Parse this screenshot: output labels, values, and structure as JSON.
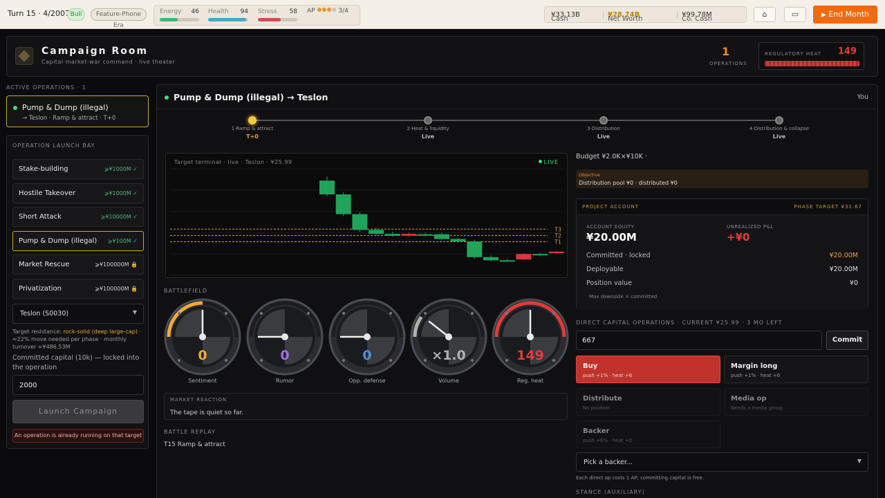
{
  "topbar": {
    "turn": "Turn 15 · 4/2007",
    "market": "Bull",
    "era": "Feature-Phone Era",
    "stats": [
      {
        "label": "Energy",
        "value": "46",
        "pct": 46,
        "color": "#4caf7d"
      },
      {
        "label": "Health",
        "value": "94",
        "pct": 94,
        "color": "#4aa3c8"
      },
      {
        "label": "Stress",
        "value": "58",
        "pct": 58,
        "color": "#d84a5a"
      }
    ],
    "ap_label": "AP",
    "ap_value": "3/4",
    "cash_label": "Cash",
    "cash_value": "¥33.13B",
    "networth_label": "Net Worth",
    "networth_value": "¥28.74B",
    "cocash_label": "Co. Cash",
    "cocash_value": "¥99.78M",
    "home_icon": "⌂",
    "screen_icon": "▭",
    "end_icon": "▶",
    "end_label": "End Month"
  },
  "header": {
    "title": "Campaign Room",
    "subtitle": "Capital market-war command · live theater",
    "ops_count": "1",
    "ops_label": "OPERATIONS",
    "heat_label": "REGULATORY HEAT",
    "heat_value": "149",
    "heat_pct": 100
  },
  "left": {
    "active_label": "ACTIVE OPERATIONS · 1",
    "active_op": {
      "title": "Pump & Dump (illegal)",
      "sub": "→ Teslon · Ramp & attract · T+0"
    },
    "bay_label": "OPERATION LAUNCH BAY",
    "ops": [
      {
        "name": "Stake-building",
        "req": "⩾¥1000M ✓",
        "state": "ok"
      },
      {
        "name": "Hostile Takeover",
        "req": "⩾¥1000M ✓",
        "state": "ok"
      },
      {
        "name": "Short Attack",
        "req": "⩾¥10000M ✓",
        "state": "ok"
      },
      {
        "name": "Pump & Dump (illegal)",
        "req": "⩾¥100M ✓",
        "state": "ok",
        "selected": true
      },
      {
        "name": "Market Rescue",
        "req": "⩾¥100000M 🔒",
        "state": "lock"
      },
      {
        "name": "Privatization",
        "req": "⩾¥100000M 🔒",
        "state": "lock"
      }
    ],
    "target_select": "Teslon (S0030)",
    "resist_prefix": "Target resistance: ",
    "resist_hl": "rock-solid (deep large-cap)",
    "resist_rest": " · ≈22% move needed per phase · monthly turnover ≈¥486.53M",
    "commit_label": "Committed capital (10k) — locked into the operation",
    "commit_value": "2000",
    "launch_label": "Launch Campaign",
    "warning": "An operation is already running on that target"
  },
  "main": {
    "title": "Pump & Dump (illegal) → Teslon",
    "you": "You",
    "phases": [
      {
        "name": "1·Ramp & attract",
        "state": "T+0",
        "active": true
      },
      {
        "name": "2·Heat & liquidity",
        "state": "Live",
        "active": false
      },
      {
        "name": "3·Distribution",
        "state": "Live",
        "active": false
      },
      {
        "name": "4·Distribution & collapse",
        "state": "Live",
        "active": false
      }
    ],
    "chart_title": "Target terminal · live · Teslon · ¥25.99",
    "live_label": "LIVE",
    "battlefield_label": "BATTLEFIELD",
    "gauges": [
      {
        "name": "Sentiment",
        "value": "0",
        "color": "#f2a93b",
        "level": 0.5
      },
      {
        "name": "Rumor",
        "value": "0",
        "color": "#a06cf0",
        "level": 0
      },
      {
        "name": "Opp. defense",
        "value": "0",
        "color": "#4a90e2",
        "level": 0
      },
      {
        "name": "Volume",
        "value": "×1.0",
        "color": "#b0b0b0",
        "level": 0.2
      },
      {
        "name": "Reg. heat",
        "value": "149",
        "color": "#e23b3b",
        "level": 1
      }
    ],
    "reaction_label": "MARKET REACTION",
    "reaction_text": "The tape is quiet so far.",
    "replay_label": "BATTLE REPLAY",
    "replay_items": [
      "T15 Ramp & attract"
    ]
  },
  "side": {
    "budget": "Budget ¥2.0K×¥10K ·",
    "objective_label": "Objective",
    "objective_text": "Distribution pool ¥0 · distributed ¥0",
    "account_title": "PROJECT ACCOUNT",
    "phase_target": "PHASE TARGET ¥31.67",
    "equity_label": "ACCOUNT EQUITY",
    "equity_value": "¥20.00M",
    "pnl_label": "UNREALIZED P&L",
    "pnl_value": "+¥0",
    "rows": [
      {
        "label": "Committed · locked",
        "value": "¥20.00M"
      },
      {
        "label": "Deployable",
        "value": "¥20.00M"
      },
      {
        "label": "Position value",
        "value": "¥0"
      }
    ],
    "note": "Max downside = committed",
    "direct_label": "DIRECT CAPITAL OPERATIONS · CURRENT ¥25.99 · 3 MO LEFT",
    "amount_value": "667",
    "commit_label": "Commit",
    "actions": [
      {
        "name": "Buy",
        "sub": "push +1% · heat +6",
        "style": "buy"
      },
      {
        "name": "Margin long",
        "sub": "push +1% · heat +6",
        "style": "normal"
      },
      {
        "name": "Distribute",
        "sub": "No position",
        "style": "disabled"
      },
      {
        "name": "Media op",
        "sub": "Needs a media group",
        "style": "disabled"
      },
      {
        "name": "Backer",
        "sub": "push +6% · heat +0",
        "style": "disabled"
      }
    ],
    "backer_select": "Pick a backer...",
    "ap_note": "Each direct op costs 1 AP; committing capital is free.",
    "stance_label": "STANCE (AUXILIARY)"
  },
  "chart_data": {
    "type": "candlestick",
    "title": "Target terminal · live · Teslon · ¥25.99",
    "levels": [
      {
        "name": "T3",
        "value": 31.7
      },
      {
        "name": "T2",
        "value": 30.1
      },
      {
        "name": "T1",
        "value": 28.5
      }
    ],
    "ylim": [
      20,
      47
    ],
    "candles": [
      {
        "o": 44.0,
        "c": 40.5,
        "h": 45.0,
        "l": 40.0
      },
      {
        "o": 40.5,
        "c": 35.5,
        "h": 41.0,
        "l": 35.0
      },
      {
        "o": 35.5,
        "c": 31.5,
        "h": 36.0,
        "l": 31.0
      },
      {
        "o": 31.5,
        "c": 30.5,
        "h": 32.0,
        "l": 30.0
      },
      {
        "o": 30.5,
        "c": 30.0,
        "h": 31.0,
        "l": 29.8
      },
      {
        "o": 30.0,
        "c": 30.5,
        "h": 30.8,
        "l": 29.8
      },
      {
        "o": 30.4,
        "c": 30.1,
        "h": 30.8,
        "l": 29.9
      },
      {
        "o": 30.4,
        "c": 29.2,
        "h": 30.8,
        "l": 29.0
      },
      {
        "o": 29.2,
        "c": 28.6,
        "h": 29.5,
        "l": 28.3
      },
      {
        "o": 28.6,
        "c": 24.6,
        "h": 29.0,
        "l": 24.2
      },
      {
        "o": 24.6,
        "c": 23.8,
        "h": 25.0,
        "l": 23.5
      },
      {
        "o": 23.8,
        "c": 23.8,
        "h": 24.2,
        "l": 23.5
      },
      {
        "o": 24.0,
        "c": 25.4,
        "h": 25.6,
        "l": 23.9
      },
      {
        "o": 25.4,
        "c": 25.1,
        "h": 25.8,
        "l": 24.8
      },
      {
        "o": 25.6,
        "c": 26.0,
        "h": 26.2,
        "l": 25.4
      }
    ]
  }
}
